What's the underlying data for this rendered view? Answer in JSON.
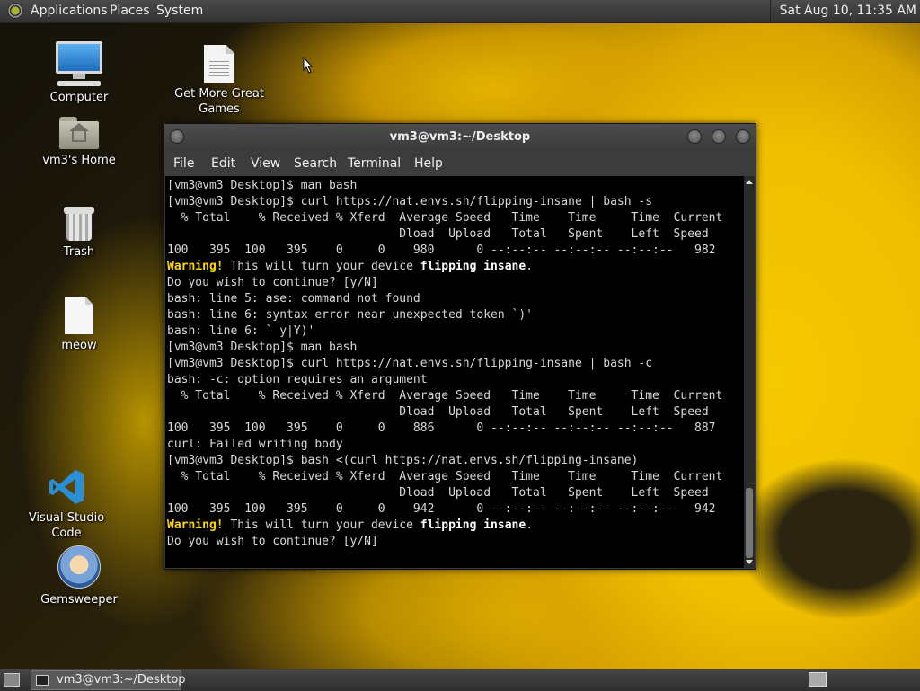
{
  "top_panel": {
    "menus": [
      "Applications",
      "Places",
      "System"
    ],
    "clock": "Sat Aug 10, 11:35 AM"
  },
  "desktop_icons": [
    {
      "label": "Computer",
      "icon": "computer-icon"
    },
    {
      "label": "Get More Great Games",
      "icon": "document-icon"
    },
    {
      "label": "vm3's Home",
      "icon": "home-folder-icon"
    },
    {
      "label": "Trash",
      "icon": "trash-icon"
    },
    {
      "label": "meow",
      "icon": "file-icon"
    },
    {
      "label": "Visual Studio Code",
      "icon": "vscode-icon"
    },
    {
      "label": "Gemsweeper",
      "icon": "gemsweeper-icon"
    }
  ],
  "terminal": {
    "title": "vm3@vm3:~/Desktop",
    "menu": [
      "File",
      "Edit",
      "View",
      "Search",
      "Terminal",
      "Help"
    ],
    "lines": [
      "[vm3@vm3 Desktop]$ man bash",
      "[vm3@vm3 Desktop]$ curl https://nat.envs.sh/flipping-insane | bash -s",
      "  % Total    % Received % Xferd  Average Speed   Time    Time     Time  Current",
      "                                 Dload  Upload   Total   Spent    Left  Speed",
      "100   395  100   395    0     0    980      0 --:--:-- --:--:-- --:--:--   982",
      "Warning! This will turn your device flipping insane.",
      "Do you wish to continue? [y/N]",
      "bash: line 5: ase: command not found",
      "bash: line 6: syntax error near unexpected token `)'",
      "bash: line 6: ` y|Y)'",
      "[vm3@vm3 Desktop]$ man bash",
      "[vm3@vm3 Desktop]$ curl https://nat.envs.sh/flipping-insane | bash -c",
      "bash: -c: option requires an argument",
      "  % Total    % Received % Xferd  Average Speed   Time    Time     Time  Current",
      "                                 Dload  Upload   Total   Spent    Left  Speed",
      "100   395  100   395    0     0    886      0 --:--:-- --:--:-- --:--:--   887",
      "curl: Failed writing body",
      "[vm3@vm3 Desktop]$ bash <(curl https://nat.envs.sh/flipping-insane)",
      "  % Total    % Received % Xferd  Average Speed   Time    Time     Time  Current",
      "                                 Dload  Upload   Total   Spent    Left  Speed",
      "100   395  100   395    0     0    942      0 --:--:-- --:--:-- --:--:--   942",
      "Warning! This will turn your device flipping insane.",
      "Do you wish to continue? [y/N]"
    ],
    "warning_prefix": "Warning!",
    "warning_bold_phrase": "flipping insane"
  },
  "bottom_panel": {
    "task_label": "vm3@vm3:~/Desktop"
  },
  "colors": {
    "warning": "#ffd700",
    "terminal_bg": "#000000",
    "terminal_fg": "#d8d8d8"
  }
}
